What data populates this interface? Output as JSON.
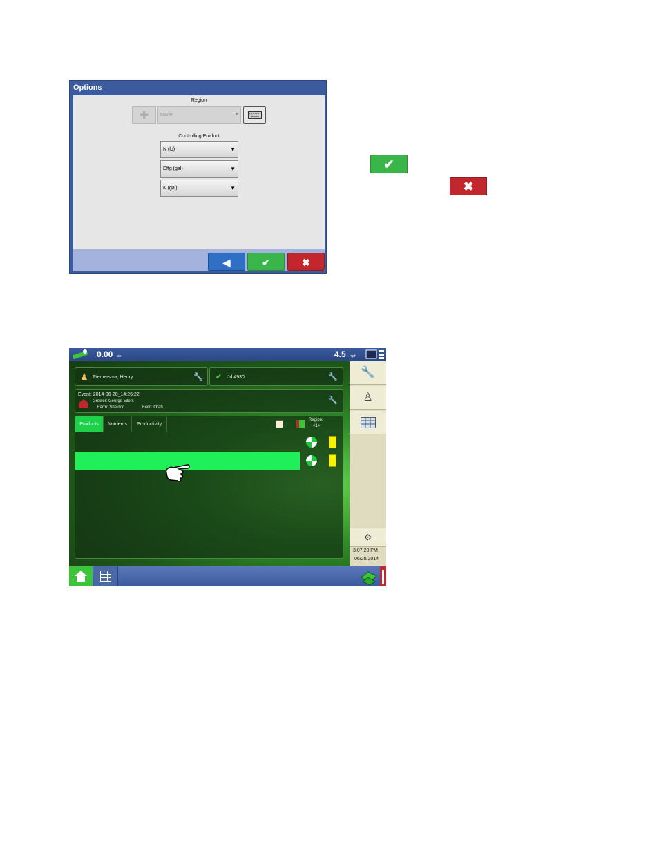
{
  "options_dialog": {
    "title": "Options",
    "region_label": "Region",
    "region_value": "NWer",
    "controlling_product_label": "Controlling Product",
    "products": [
      "N (lb)",
      "Dffg (gal)",
      "K (gal)"
    ],
    "dropdown_arrow": "▼"
  },
  "footer_buttons": {
    "back_icon": "◀",
    "accept_icon": "✔",
    "cancel_icon": "✖"
  },
  "standalone": {
    "accept_icon": "✔",
    "cancel_icon": "✖"
  },
  "main_screen": {
    "speed_left": "0.00",
    "speed_left_unit": "ac",
    "speed_right": "4.5",
    "speed_right_unit": "mph",
    "operator": "Riemersma, Henry",
    "machine": "Jd 4930",
    "event": "Event: 2014-06-20_14:26:22",
    "grower": "Grower: George Eilers",
    "farm": "Farm: Sheldon",
    "field": "Field: Orab",
    "tabs": [
      "Products",
      "Nutrients",
      "Productivity"
    ],
    "region_label": "Region:",
    "region_value": "<1>",
    "time": "3:07:20 PM",
    "date": "06/20/2014"
  },
  "colors": {
    "dialog_blue": "#3b5b9e",
    "accept_green": "#39b54a",
    "cancel_red": "#c1272d",
    "highlight_green": "#1ff05a"
  }
}
